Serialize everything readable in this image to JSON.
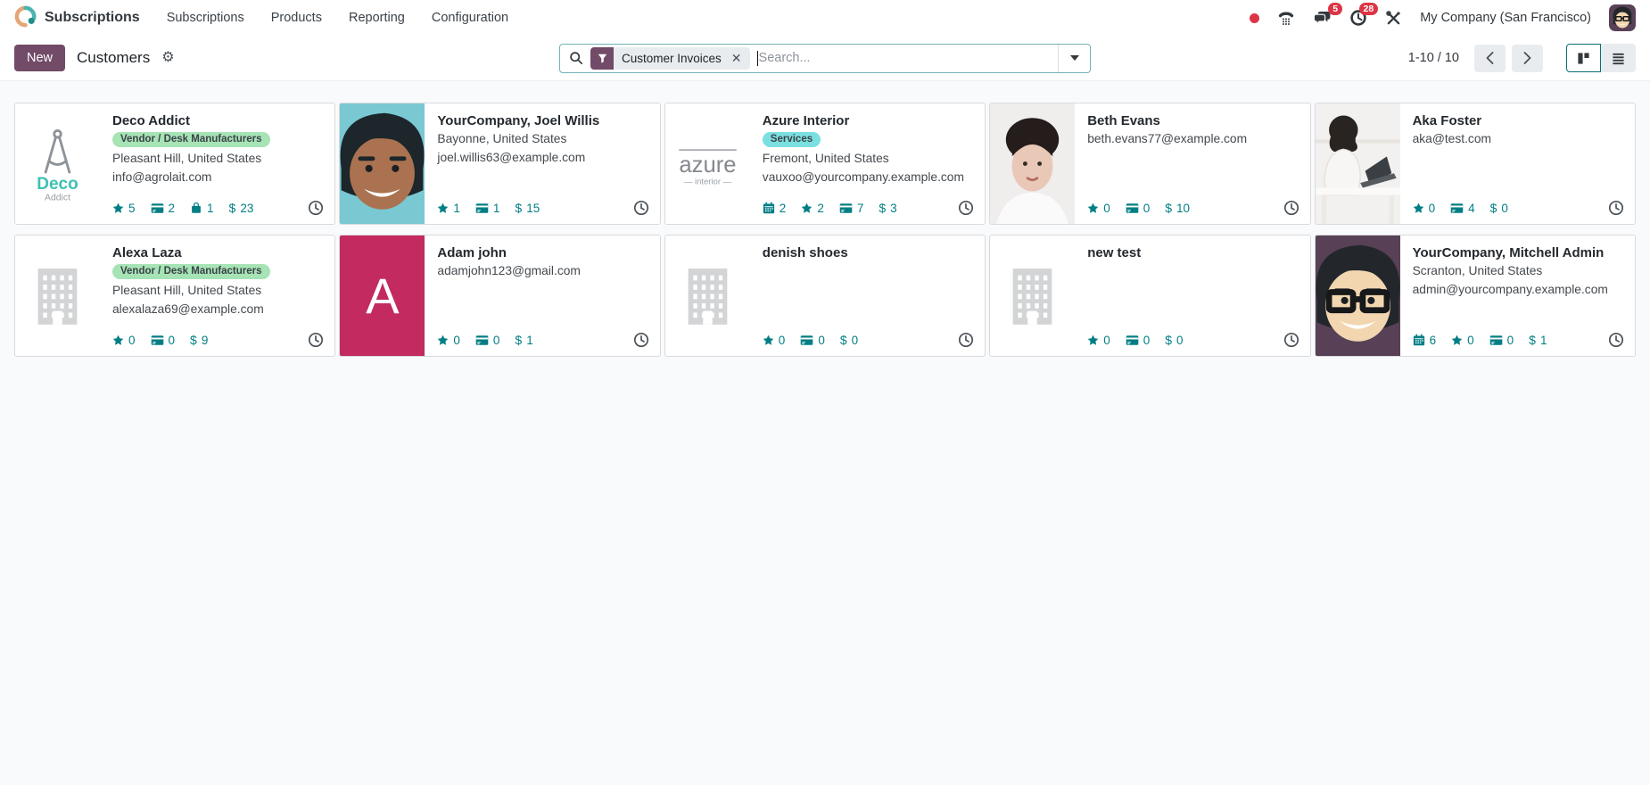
{
  "colors": {
    "accent_teal": "#017e84",
    "primary_purple": "#714B67",
    "badge_red": "#dc3545"
  },
  "nav": {
    "app_name": "Subscriptions",
    "menus": [
      "Subscriptions",
      "Products",
      "Reporting",
      "Configuration"
    ],
    "systray": {
      "message_badge": "5",
      "activity_badge": "28",
      "company": "My Company (San Francisco)"
    }
  },
  "control_panel": {
    "new_button": "New",
    "breadcrumb": "Customers",
    "search": {
      "facet": "Customer Invoices",
      "placeholder": "Search..."
    },
    "pager": "1-10 / 10"
  },
  "cards": [
    {
      "name": "Deco Addict",
      "tag": {
        "label": "Vendor / Desk Manufacturers",
        "bg": "#a6e3b5"
      },
      "city": "Pleasant Hill, United States",
      "email": "info@agrolait.com",
      "stats": [
        {
          "icon": "star",
          "value": "5"
        },
        {
          "icon": "invoice",
          "value": "2"
        },
        {
          "icon": "bag",
          "value": "1"
        },
        {
          "icon": "dollar",
          "value": "23"
        }
      ],
      "avatar": {
        "type": "logo-deco",
        "line1": "Deco",
        "line2": "Addict"
      }
    },
    {
      "name": "YourCompany, Joel Willis",
      "city": "Bayonne, United States",
      "email": "joel.willis63@example.com",
      "stats": [
        {
          "icon": "star",
          "value": "1"
        },
        {
          "icon": "invoice",
          "value": "1"
        },
        {
          "icon": "dollar",
          "value": "15"
        }
      ],
      "avatar": {
        "type": "portrait",
        "bg": "#79c8d2",
        "skin": "#aa7250",
        "hair": "#1c262b",
        "glasses": false
      }
    },
    {
      "name": "Azure Interior",
      "tag": {
        "label": "Services",
        "bg": "#7bdfe0"
      },
      "city": "Fremont, United States",
      "email": "vauxoo@yourcompany.example.com",
      "stats": [
        {
          "icon": "calendar",
          "value": "2"
        },
        {
          "icon": "star",
          "value": "2"
        },
        {
          "icon": "invoice",
          "value": "7"
        },
        {
          "icon": "dollar",
          "value": "3"
        }
      ],
      "avatar": {
        "type": "logo-azure",
        "line1": "azure",
        "line2": "interior"
      }
    },
    {
      "name": "Beth Evans",
      "email": "beth.evans77@example.com",
      "stats": [
        {
          "icon": "star",
          "value": "0"
        },
        {
          "icon": "invoice",
          "value": "0"
        },
        {
          "icon": "dollar",
          "value": "10"
        }
      ],
      "avatar": {
        "type": "portrait-photo",
        "bg": "#f0eded",
        "skin": "#e9c8b8",
        "hair": "#241d1b"
      }
    },
    {
      "name": "Aka Foster",
      "email": "aka@test.com",
      "stats": [
        {
          "icon": "star",
          "value": "0"
        },
        {
          "icon": "invoice",
          "value": "4"
        },
        {
          "icon": "dollar",
          "value": "0"
        }
      ],
      "avatar": {
        "type": "photo-desk",
        "bg": "#f3f1ef",
        "hair": "#2a2420"
      }
    },
    {
      "name": "Alexa Laza",
      "tag": {
        "label": "Vendor / Desk Manufacturers",
        "bg": "#a6e3b5"
      },
      "city": "Pleasant Hill, United States",
      "email": "alexalaza69@example.com",
      "stats": [
        {
          "icon": "star",
          "value": "0"
        },
        {
          "icon": "invoice",
          "value": "0"
        },
        {
          "icon": "dollar",
          "value": "9"
        }
      ],
      "avatar": {
        "type": "building"
      }
    },
    {
      "name": "Adam john",
      "email": "adamjohn123@gmail.com",
      "stats": [
        {
          "icon": "star",
          "value": "0"
        },
        {
          "icon": "invoice",
          "value": "0"
        },
        {
          "icon": "dollar",
          "value": "1"
        }
      ],
      "avatar": {
        "type": "letter",
        "bg": "#c22a60",
        "letter": "A"
      }
    },
    {
      "name": "denish shoes",
      "stats": [
        {
          "icon": "star",
          "value": "0"
        },
        {
          "icon": "invoice",
          "value": "0"
        },
        {
          "icon": "dollar",
          "value": "0"
        }
      ],
      "avatar": {
        "type": "building"
      }
    },
    {
      "name": "new test",
      "stats": [
        {
          "icon": "star",
          "value": "0"
        },
        {
          "icon": "invoice",
          "value": "0"
        },
        {
          "icon": "dollar",
          "value": "0"
        }
      ],
      "avatar": {
        "type": "building"
      }
    },
    {
      "name": "YourCompany, Mitchell Admin",
      "city": "Scranton, United States",
      "email": "admin@yourcompany.example.com",
      "stats": [
        {
          "icon": "calendar",
          "value": "6"
        },
        {
          "icon": "star",
          "value": "0"
        },
        {
          "icon": "invoice",
          "value": "0"
        },
        {
          "icon": "dollar",
          "value": "1"
        }
      ],
      "avatar": {
        "type": "portrait",
        "bg": "#584157",
        "skin": "#f2d6b0",
        "hair": "#23272b",
        "glasses": true
      }
    }
  ]
}
